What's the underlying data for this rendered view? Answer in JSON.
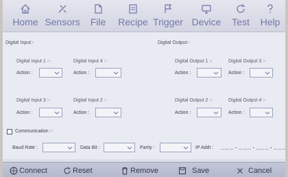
{
  "toolbar": {
    "items": [
      {
        "label": "Home",
        "icon": "home-icon"
      },
      {
        "label": "Sensors",
        "icon": "sensor-icon"
      },
      {
        "label": "File",
        "icon": "file-icon"
      },
      {
        "label": "Recipe",
        "icon": "recipe-icon"
      },
      {
        "label": "Trigger",
        "icon": "flag-icon"
      },
      {
        "label": "Device",
        "icon": "monitor-icon"
      },
      {
        "label": "Test",
        "icon": "refresh-icon"
      },
      {
        "label": "Help",
        "icon": "help-icon"
      }
    ]
  },
  "inputs": {
    "title": "Digital Input:-",
    "items": [
      {
        "label": "Digital Input 1 :-",
        "action_label": "Action :",
        "action_value": ""
      },
      {
        "label": "Digital Input 4 :-",
        "action_label": "Action :",
        "action_value": ""
      },
      {
        "label": "Digital Input 3 :-",
        "action_label": "Action :",
        "action_value": ""
      },
      {
        "label": "Digital Input 2 :-",
        "action_label": "Action :",
        "action_value": ""
      }
    ]
  },
  "outputs": {
    "title": "Digital Output:-",
    "items": [
      {
        "label": "Digital Output 1 :-",
        "action_label": "Action :",
        "action_value": ""
      },
      {
        "label": "Digital Output 3 :-",
        "action_label": "Action :",
        "action_value": ""
      },
      {
        "label": "Digital Output 2 :-",
        "action_label": "Action :",
        "action_value": ""
      },
      {
        "label": "Digital Output 4 :-",
        "action_label": "Action :",
        "action_value": ""
      }
    ]
  },
  "communication": {
    "label": "Communication :-",
    "checked": false,
    "baud_rate_label": "Baud Rate :",
    "data_bit_label": "Data Bit :",
    "parity_label": "Parity :",
    "ip_label": "IP Addr :",
    "ip_value": "___.___.___.___"
  },
  "bottombar": {
    "connect": "Connect",
    "reset": "Reset",
    "remove": "Remove",
    "save": "Save",
    "cancel": "Cancel"
  },
  "colors": {
    "toolbar_icon": "#6d74a6",
    "content_bg": "#e9ebf3",
    "bottom_bg": "#b9bdd0"
  }
}
